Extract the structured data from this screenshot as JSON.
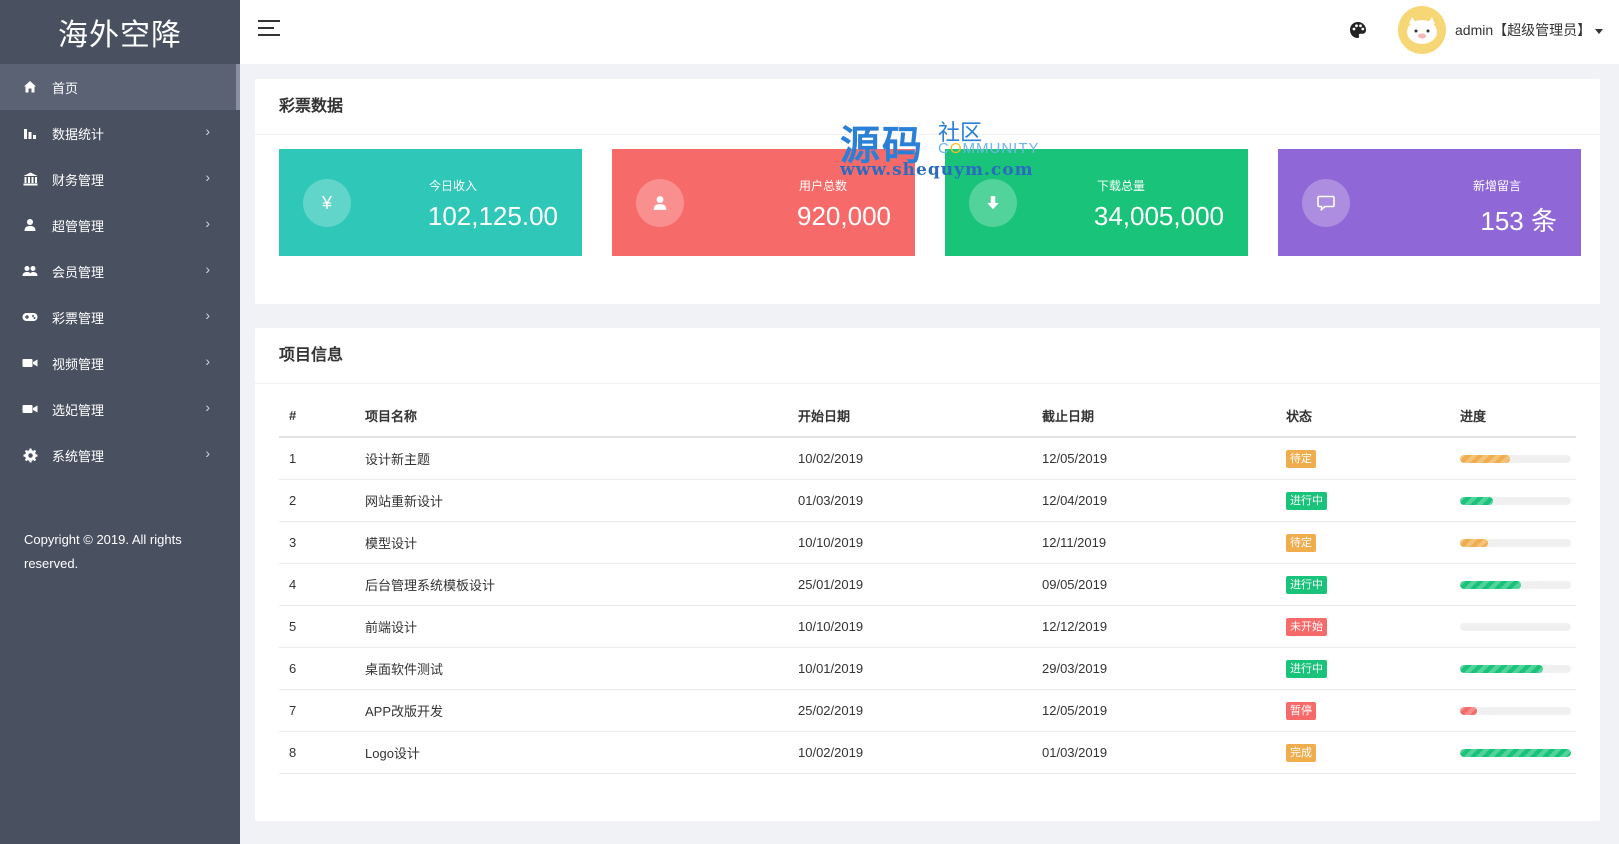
{
  "brand": "海外空降",
  "sidebar": {
    "items": [
      {
        "label": "首页",
        "icon": "home-icon",
        "active": true
      },
      {
        "label": "数据统计",
        "icon": "bar-chart-icon"
      },
      {
        "label": "财务管理",
        "icon": "bank-icon"
      },
      {
        "label": "超管管理",
        "icon": "user-icon"
      },
      {
        "label": "会员管理",
        "icon": "users-icon"
      },
      {
        "label": "彩票管理",
        "icon": "gamepad-icon"
      },
      {
        "label": "视频管理",
        "icon": "video-camera-icon"
      },
      {
        "label": "选妃管理",
        "icon": "video-camera-icon"
      },
      {
        "label": "系统管理",
        "icon": "gear-icon"
      }
    ],
    "copyright": "Copyright © 2019. All rights reserved."
  },
  "header": {
    "user": "admin【超级管理员】"
  },
  "lottery": {
    "title": "彩票数据",
    "stats": [
      {
        "label": "今日收入",
        "value": "102,125.00",
        "icon_glyph": "¥",
        "color": "#2ec7b8"
      },
      {
        "label": "用户总数",
        "value": "920,000",
        "icon_glyph": "",
        "color": "#f76a6a"
      },
      {
        "label": "下载总量",
        "value": "34,005,000",
        "icon_glyph": "",
        "color": "#19c47a"
      },
      {
        "label": "新增留言",
        "value": "153 条",
        "icon_glyph": "",
        "color": "#9067d6"
      }
    ]
  },
  "watermark": {
    "big": "源码",
    "small": "社区",
    "community_a": "C",
    "community_o": "O",
    "community_b": "MMUNITY",
    "url": "www.shequym.com"
  },
  "projects": {
    "title": "项目信息",
    "columns": [
      "#",
      "项目名称",
      "开始日期",
      "截止日期",
      "状态",
      "进度"
    ],
    "rows": [
      {
        "id": "1",
        "name": "设计新主题",
        "start": "10/02/2019",
        "end": "12/05/2019",
        "status": "待定",
        "status_color": "#f0ad4e",
        "progress": 0.45,
        "bar_color": "#f0ad4e"
      },
      {
        "id": "2",
        "name": "网站重新设计",
        "start": "01/03/2019",
        "end": "12/04/2019",
        "status": "进行中",
        "status_color": "#19c47a",
        "progress": 0.3,
        "bar_color": "#19c47a"
      },
      {
        "id": "3",
        "name": "模型设计",
        "start": "10/10/2019",
        "end": "12/11/2019",
        "status": "待定",
        "status_color": "#f0ad4e",
        "progress": 0.25,
        "bar_color": "#f0ad4e"
      },
      {
        "id": "4",
        "name": "后台管理系统模板设计",
        "start": "25/01/2019",
        "end": "09/05/2019",
        "status": "进行中",
        "status_color": "#19c47a",
        "progress": 0.55,
        "bar_color": "#19c47a"
      },
      {
        "id": "5",
        "name": "前端设计",
        "start": "10/10/2019",
        "end": "12/12/2019",
        "status": "未开始",
        "status_color": "#f76a6a",
        "progress": 0,
        "bar_color": "#f76a6a"
      },
      {
        "id": "6",
        "name": "桌面软件测试",
        "start": "10/01/2019",
        "end": "29/03/2019",
        "status": "进行中",
        "status_color": "#19c47a",
        "progress": 0.75,
        "bar_color": "#19c47a"
      },
      {
        "id": "7",
        "name": "APP改版开发",
        "start": "25/02/2019",
        "end": "12/05/2019",
        "status": "暂停",
        "status_color": "#f76a6a",
        "progress": 0.15,
        "bar_color": "#f76a6a"
      },
      {
        "id": "8",
        "name": "Logo设计",
        "start": "10/02/2019",
        "end": "01/03/2019",
        "status": "完成",
        "status_color": "#f0ad4e",
        "progress": 1.0,
        "bar_color": "#19c47a"
      }
    ]
  }
}
